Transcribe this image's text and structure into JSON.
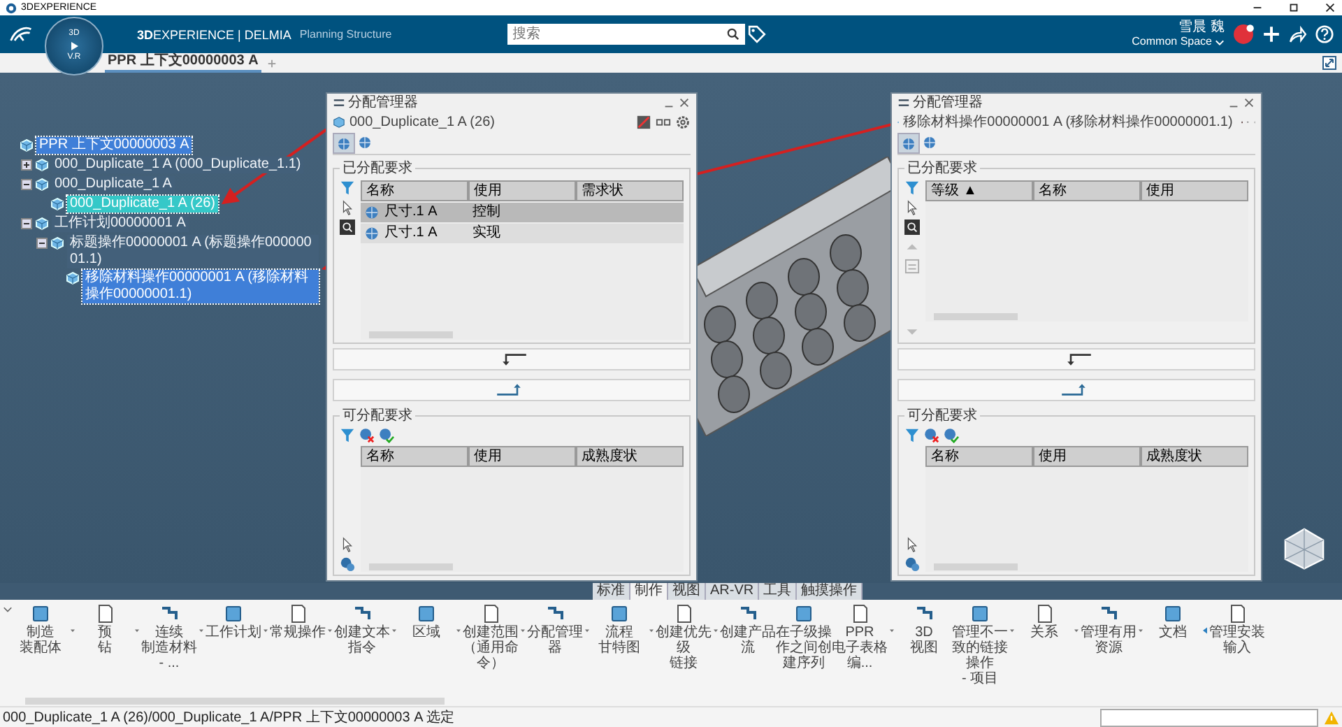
{
  "app_title": "3DEXPERIENCE",
  "header": {
    "compass": {
      "top": "3D",
      "bottom": "V.R"
    },
    "brand": "**3D**EXPERIENCE | DELMIA",
    "app_name": "Planning Structure",
    "search": {
      "placeholder": "搜索"
    },
    "user_name": "雪晨 魏",
    "space": "Common Space"
  },
  "tabs": [
    {
      "label": "PPR 上下文00000003 A",
      "selected": true
    }
  ],
  "tree": [
    {
      "label": "PPR 上下文00000003 A",
      "selected": true,
      "color": "#3f7fd8",
      "children": [
        {
          "label": "000_Duplicate_1 A (000_Duplicate_1.1)",
          "selected": false,
          "expanded": false
        },
        {
          "label": "000_Duplicate_1 A",
          "selected": false,
          "expanded": true,
          "children": [
            {
              "label": "000_Duplicate_1 A (26)",
              "selected": true,
              "color": "#35c8c8"
            }
          ]
        },
        {
          "label": "工作计划00000001 A",
          "selected": false,
          "expanded": true,
          "children": [
            {
              "label": "标题操作00000001 A (标题操作00000001.1)",
              "selected": false,
              "expanded": true,
              "children": [
                {
                  "label": "移除材料操作00000001 A (移除材料操作00000001.1)",
                  "selected": true,
                  "color": "#3f7fd8"
                }
              ]
            }
          ]
        }
      ]
    }
  ],
  "dialogs": [
    {
      "title": "分配管理器",
      "object": "000_Duplicate_1 A (26)",
      "view_tabs": [
        {
          "selected": true
        },
        {
          "selected": false
        }
      ],
      "reorder_tools": false,
      "assigned": {
        "title": "已分配要求",
        "columns": [
          {
            "label": "名称"
          },
          {
            "label": "使用"
          },
          {
            "label": "需求状"
          }
        ],
        "rows": [
          {
            "name": "尺寸.1 A",
            "use": "控制",
            "selected": true
          },
          {
            "name": "尺寸.1 A",
            "use": "实现",
            "selected": false
          }
        ]
      },
      "available": {
        "title": "可分配要求",
        "columns": [
          {
            "label": "名称"
          },
          {
            "label": "使用"
          },
          {
            "label": "成熟度状"
          }
        ]
      }
    },
    {
      "title": "分配管理器",
      "object": "移除材料操作00000001 A (移除材料操作00000001.1)",
      "view_tabs": [
        {
          "selected": true
        },
        {
          "selected": false
        }
      ],
      "reorder_tools": true,
      "assigned": {
        "title": "已分配要求",
        "columns": [
          {
            "label": "等级",
            "sort": "▲"
          },
          {
            "label": "名称"
          },
          {
            "label": "使用"
          }
        ]
      },
      "available": {
        "title": "可分配要求",
        "columns": [
          {
            "label": "名称"
          },
          {
            "label": "使用"
          },
          {
            "label": "成熟度状"
          }
        ]
      }
    }
  ],
  "toolbar_tabs": [
    {
      "label": "标准",
      "selected": false
    },
    {
      "label": "制作",
      "selected": true
    },
    {
      "label": "视图",
      "selected": false
    },
    {
      "label": "AR-VR",
      "selected": false
    },
    {
      "label": "工具",
      "selected": false
    },
    {
      "label": "触摸操作",
      "selected": false
    }
  ],
  "tools": [
    {
      "lines": [
        "制造",
        "装配体"
      ],
      "has_menu": true
    },
    {
      "lines": [
        "预",
        "钻"
      ],
      "has_menu": true
    },
    {
      "lines": [
        "连续",
        "制造材料 - ..."
      ],
      "has_menu": true
    },
    {
      "lines": [
        "工作计划"
      ],
      "has_menu": true
    },
    {
      "lines": [
        "常规操作"
      ],
      "has_menu": true
    },
    {
      "lines": [
        "创建文本指令"
      ],
      "has_menu": true
    },
    {
      "lines": [
        "区域"
      ],
      "has_menu": true
    },
    {
      "lines": [
        "创建范围（通用命令）"
      ],
      "has_menu": true
    },
    {
      "lines": [
        "分配管理器"
      ],
      "has_menu": true
    },
    {
      "lines": [
        "流程",
        "甘特图"
      ],
      "has_menu": true
    },
    {
      "lines": [
        "创建优先级",
        "链接"
      ],
      "has_menu": true
    },
    {
      "lines": [
        "创建产品",
        "流"
      ],
      "has_menu": false
    },
    {
      "lines": [
        "在子级操作之间创建序列"
      ],
      "has_menu": false
    },
    {
      "lines": [
        "PPR",
        "电子表格编..."
      ],
      "has_menu": true
    },
    {
      "lines": [
        "3D",
        "视图"
      ],
      "has_menu": false
    },
    {
      "lines": [
        "管理不一致的链接操作",
        "- 项目"
      ],
      "has_menu": true
    },
    {
      "lines": [
        "关系"
      ],
      "has_menu": true
    },
    {
      "lines": [
        "管理有用",
        "资源"
      ],
      "has_menu": true
    },
    {
      "lines": [
        "文档"
      ],
      "has_menu": false
    },
    {
      "lines": [
        "管理安装输入"
      ],
      "has_menu": false
    }
  ],
  "status_bar": {
    "text": "000_Duplicate_1 A (26)/000_Duplicate_1 A/PPR 上下文00000003 A 选定"
  }
}
